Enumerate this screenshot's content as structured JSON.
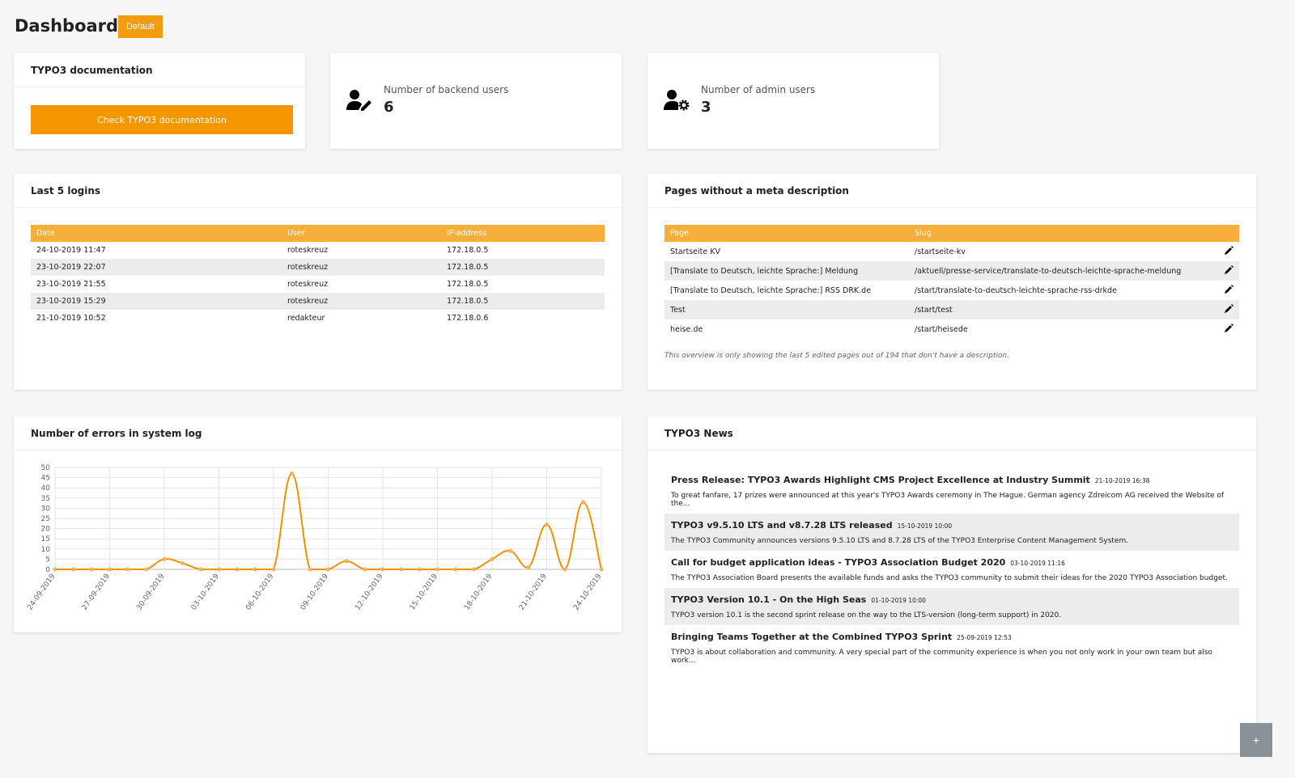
{
  "header": {
    "title": "Dashboard",
    "preset": "Default"
  },
  "doc": {
    "title": "TYPO3 documentation",
    "button": "Check TYPO3 documentation"
  },
  "backend_users": {
    "label": "Number of backend users",
    "value": "6",
    "icon": "user-edit-icon"
  },
  "admin_users": {
    "label": "Number of admin users",
    "value": "3",
    "icon": "user-cog-icon"
  },
  "logins": {
    "title": "Last 5 logins",
    "columns": [
      "Date",
      "User",
      "IP-address"
    ],
    "rows": [
      [
        "24-10-2019 11:47",
        "roteskreuz",
        "172.18.0.5"
      ],
      [
        "23-10-2019 22:07",
        "roteskreuz",
        "172.18.0.5"
      ],
      [
        "23-10-2019 21:55",
        "roteskreuz",
        "172.18.0.5"
      ],
      [
        "23-10-2019 15:29",
        "roteskreuz",
        "172.18.0.5"
      ],
      [
        "21-10-2019 10:52",
        "redakteur",
        "172.18.0.6"
      ]
    ]
  },
  "meta": {
    "title": "Pages without a meta description",
    "columns": [
      "Page",
      "Slug"
    ],
    "rows": [
      [
        "Startseite KV",
        "/startseite-kv"
      ],
      [
        "[Translate to Deutsch, leichte Sprache:] Meldung",
        "/aktuell/presse-service/translate-to-deutsch-leichte-sprache-meldung"
      ],
      [
        "[Translate to Deutsch, leichte Sprache:] RSS DRK.de",
        "/start/translate-to-deutsch-leichte-sprache-rss-drkde"
      ],
      [
        "Test",
        "/start/test"
      ],
      [
        "heise.de",
        "/start/heisede"
      ]
    ],
    "note": "This overview is only showing the last 5 edited pages out of 194 that don't have a description."
  },
  "errors": {
    "title": "Number of errors in system log"
  },
  "chart_data": {
    "type": "line",
    "color": "#f39200",
    "ylim": [
      0,
      50
    ],
    "yticks": [
      0,
      5,
      10,
      15,
      20,
      25,
      30,
      35,
      40,
      45,
      50
    ],
    "grid": true,
    "x": [
      "24-09-2019",
      "25-09-2019",
      "26-09-2019",
      "27-09-2019",
      "28-09-2019",
      "29-09-2019",
      "30-09-2019",
      "01-10-2019",
      "02-10-2019",
      "03-10-2019",
      "04-10-2019",
      "05-10-2019",
      "06-10-2019",
      "07-10-2019",
      "08-10-2019",
      "09-10-2019",
      "10-10-2019",
      "11-10-2019",
      "12-10-2019",
      "13-10-2019",
      "14-10-2019",
      "15-10-2019",
      "16-10-2019",
      "17-10-2019",
      "18-10-2019",
      "19-10-2019",
      "20-10-2019",
      "21-10-2019",
      "22-10-2019",
      "23-10-2019",
      "24-10-2019"
    ],
    "values": [
      0,
      0,
      0,
      0,
      0,
      0,
      5,
      3,
      0,
      0,
      0,
      0,
      0,
      47,
      0,
      0,
      4,
      0,
      0,
      0,
      0,
      0,
      0,
      0,
      5,
      9,
      1,
      22,
      0,
      33,
      0
    ],
    "xtick_labels": [
      "24-09-2019",
      "27-09-2019",
      "30-09-2019",
      "03-10-2019",
      "06-10-2019",
      "09-10-2019",
      "12-10-2019",
      "15-10-2019",
      "18-10-2019",
      "21-10-2019",
      "24-10-2019"
    ]
  },
  "news": {
    "title": "TYPO3 News",
    "items": [
      {
        "title": "Press Release: TYPO3 Awards Highlight CMS Project Excellence at Industry Summit",
        "date": "21-10-2019 16:38",
        "text": "To great fanfare, 17 prizes were announced at this year's TYPO3 Awards ceremony in The Hague. German agency Zdreicom AG received the Website of the..."
      },
      {
        "title": "TYPO3 v9.5.10 LTS and v8.7.28 LTS released",
        "date": "15-10-2019 10:00",
        "text": "The TYPO3 Community announces versions 9.5.10 LTS and 8.7.28 LTS of the TYPO3 Enterprise Content Management System."
      },
      {
        "title": "Call for budget application ideas - TYPO3 Association Budget 2020",
        "date": "03-10-2019 11:16",
        "text": "The TYPO3 Association Board presents the available funds and asks the TYPO3 community to submit their ideas for the 2020 TYPO3 Association budget."
      },
      {
        "title": "TYPO3 Version 10.1 - On the High Seas",
        "date": "01-10-2019 10:00",
        "text": "TYPO3 version 10.1 is the second sprint release on the way to the LTS-version (long-term support) in 2020."
      },
      {
        "title": "Bringing Teams Together at the Combined TYPO3 Sprint",
        "date": "25-09-2019 12:53",
        "text": "TYPO3 is about collaboration and community. A very special part of the community experience is when you not only work in your own team but also work..."
      }
    ]
  },
  "add_widget": "+"
}
